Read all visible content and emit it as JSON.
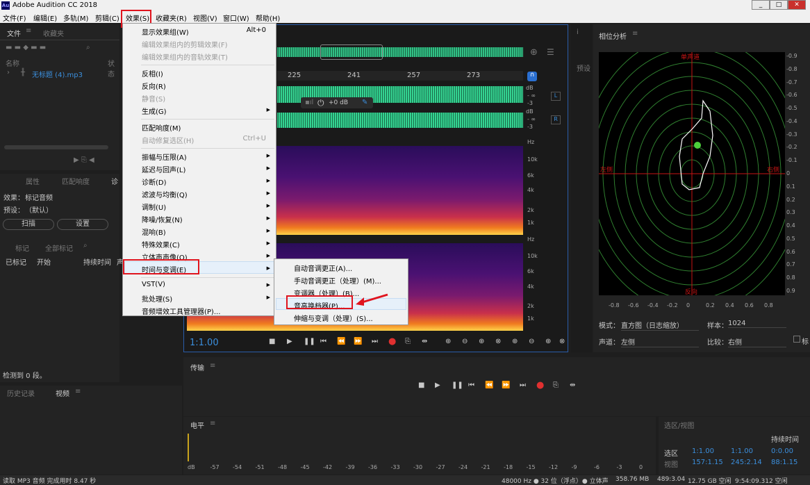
{
  "title_bar": {
    "logo": "Au",
    "title": "Adobe Audition CC 2018",
    "buttons": [
      "_",
      "□",
      "✕"
    ]
  },
  "menu_bar": [
    "文件(F)",
    "编辑(E)",
    "多轨(M)",
    "剪辑(C)",
    "效果(S)",
    "收藏夹(R)",
    "视图(V)",
    "窗口(W)",
    "帮助(H)"
  ],
  "files_panel": {
    "tabs": [
      "文件",
      "收藏夹"
    ],
    "col_name": "名称",
    "col_status": "状态",
    "file": "无标题 (4).mp3"
  },
  "effects_panel": {
    "tabs": [
      "属性",
      "匹配响度",
      "诊"
    ],
    "effect_label": "效果：",
    "effect_value": "标记音频",
    "preset_label": "预设：",
    "preset_value": "（默认）",
    "scan_button": "扫描",
    "settings_button": "设置",
    "mark_button": "标记",
    "mark_all_button": "全部标记",
    "col_marked": "已标记",
    "col_start": "开始",
    "col_duration": "持续时间",
    "col_extra": "声",
    "detected": "检测到 0 段。"
  },
  "bottom_left": {
    "history_tab": "历史记录",
    "video_tab": "视频"
  },
  "effects_menu": {
    "items": [
      {
        "label": "显示效果组(W)",
        "shortcut": "Alt+0",
        "disabled": false
      },
      {
        "label": "编辑效果组内的剪辑效果(F)",
        "disabled": true
      },
      {
        "label": "编辑效果组内的音轨效果(T)",
        "disabled": true
      },
      {
        "label": "反相(I)",
        "disabled": false
      },
      {
        "label": "反向(R)",
        "disabled": false
      },
      {
        "label": "静音(S)",
        "disabled": true
      },
      {
        "label": "生成(G)",
        "disabled": false
      },
      {
        "label": "匹配响度(M)",
        "disabled": false
      },
      {
        "label": "自动修复选区(H)",
        "shortcut": "Ctrl+U",
        "disabled": true
      },
      {
        "label": "振幅与压限(A)"
      },
      {
        "label": "延迟与回声(L)"
      },
      {
        "label": "诊断(D)"
      },
      {
        "label": "滤波与均衡(Q)"
      },
      {
        "label": "调制(U)"
      },
      {
        "label": "降噪/恢复(N)"
      },
      {
        "label": "混响(B)"
      },
      {
        "label": "特殊效果(C)"
      },
      {
        "label": "立体声声像(O)"
      },
      {
        "label": "时间与变调(E)"
      },
      {
        "label": "VST(V)"
      },
      {
        "label": "批处理(S)"
      },
      {
        "label": "音频增效工具管理器(P)..."
      }
    ]
  },
  "time_pitch_submenu": [
    "自动音调更正(A)...",
    "手动音调更正（处理）(M)...",
    "变调器（处理）(B)...",
    "音高换档器(P)...",
    "伸缩与变调（处理）(S)..."
  ],
  "editor": {
    "ruler": [
      "225",
      "241",
      "257",
      "273"
    ],
    "db_labels": [
      "dB",
      "- ∞",
      "-3",
      "dB",
      "- ∞",
      "-3"
    ],
    "channel_L": "L",
    "channel_R": "R",
    "gain": "+0 dB",
    "hz_labels_top": [
      "Hz",
      "10k",
      "6k",
      "4k",
      "2k",
      "1k"
    ],
    "hz_labels_bot": [
      "Hz",
      "10k",
      "6k",
      "4k",
      "2k",
      "1k"
    ],
    "timecode": "1:1.00"
  },
  "phase_panel": {
    "title": "相位分析",
    "label_top": "单声道",
    "label_left": "左侧",
    "label_right": "右侧",
    "label_bottom": "反向",
    "y_ticks": [
      "-0.9",
      "-0.8",
      "-0.7",
      "-0.6",
      "-0.5",
      "-0.4",
      "-0.3",
      "-0.2",
      "-0.1",
      "0",
      "0.1",
      "0.2",
      "0.3",
      "0.4",
      "0.5",
      "0.6",
      "0.7",
      "0.8",
      "0.9"
    ],
    "x_ticks": [
      "-0.8",
      "-0.6",
      "-0.4",
      "-0.2",
      "0",
      "0.2",
      "0.4",
      "0.6",
      "0.8"
    ],
    "mode_label": "模式：",
    "mode_value": "直方图（日志缩放）",
    "samples_label": "样本：",
    "samples_value": "1024",
    "channel_label": "声道：",
    "channel_value": "左侧",
    "compare_label": "比较：",
    "compare_value": "右侧",
    "checkbox_label": "标"
  },
  "side_strip": {
    "info": "i",
    "preset": "预设"
  },
  "transport": {
    "title": "传输"
  },
  "levels": {
    "title": "电平",
    "scale": [
      "dB",
      "-57",
      "-54",
      "-51",
      "-48",
      "-45",
      "-42",
      "-39",
      "-36",
      "-33",
      "-30",
      "-27",
      "-24",
      "-21",
      "-18",
      "-15",
      "-12",
      "-9",
      "-6",
      "-3",
      "0"
    ]
  },
  "selection_view": {
    "title": "选区/视图",
    "duration_hdr": "持续时间",
    "row_label": "选区",
    "start": "1:1.00",
    "end": "1:1.00",
    "duration": "0:0.00",
    "sel_partial": "视图",
    "view_start": "157:1.15",
    "view_end": "245:2.14",
    "view_duration": "88:1.15"
  },
  "status_bar": {
    "left": "读取 MP3 音频 完成用时 8.47 秒",
    "format": "48000 Hz ● 32 位（浮点）● 立体声",
    "size": "358.76 MB",
    "duration": "489:3.04",
    "free": "12.75 GB 空闲",
    "extra": "9:54:09.312 空闲"
  },
  "colors": {
    "accent": "#3b8fdd",
    "highlight": "#e0141e",
    "phase_grid": "#2f7f2f",
    "phase_axis": "#c81414"
  }
}
